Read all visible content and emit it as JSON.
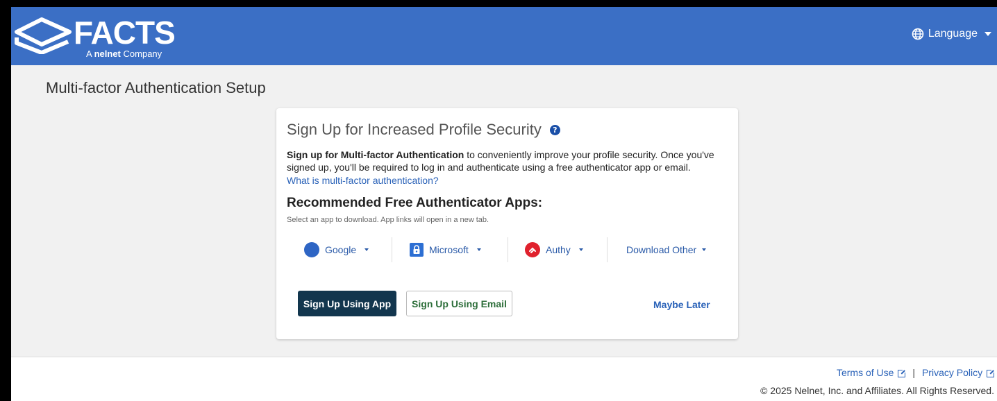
{
  "header": {
    "logo_text": "FACTS",
    "logo_sub_prefix": "A",
    "logo_sub_brand": "nelnet",
    "logo_sub_suffix": "Company",
    "language_label": "Language"
  },
  "page": {
    "title": "Multi-factor Authentication Setup"
  },
  "card": {
    "title": "Sign Up for Increased Profile Security",
    "desc_bold": "Sign up for Multi-factor Authentication",
    "desc_rest": " to conveniently improve your profile security. Once you've signed up, you'll be required to log in and authenticate using a free authenticator app or email.",
    "what_link": "What is multi-factor authentication?",
    "rec_heading": "Recommended Free Authenticator Apps:",
    "rec_sub": "Select an app to download. App links will open in a new tab.",
    "apps": [
      {
        "label": "Google",
        "icon": "google-icon"
      },
      {
        "label": "Microsoft",
        "icon": "microsoft-authenticator-icon"
      },
      {
        "label": "Authy",
        "icon": "authy-icon"
      },
      {
        "label": "Download Other",
        "icon": ""
      }
    ],
    "btn_app": "Sign Up Using App",
    "btn_email": "Sign Up Using Email",
    "maybe_later": "Maybe Later"
  },
  "footer": {
    "terms": "Terms of Use",
    "separator": "|",
    "privacy": "Privacy Policy",
    "copyright": "© 2025 Nelnet, Inc. and Affiliates. All Rights Reserved."
  },
  "colors": {
    "header_bg": "#3b6fc5",
    "primary_button": "#12364e",
    "link": "#2a62b8"
  }
}
